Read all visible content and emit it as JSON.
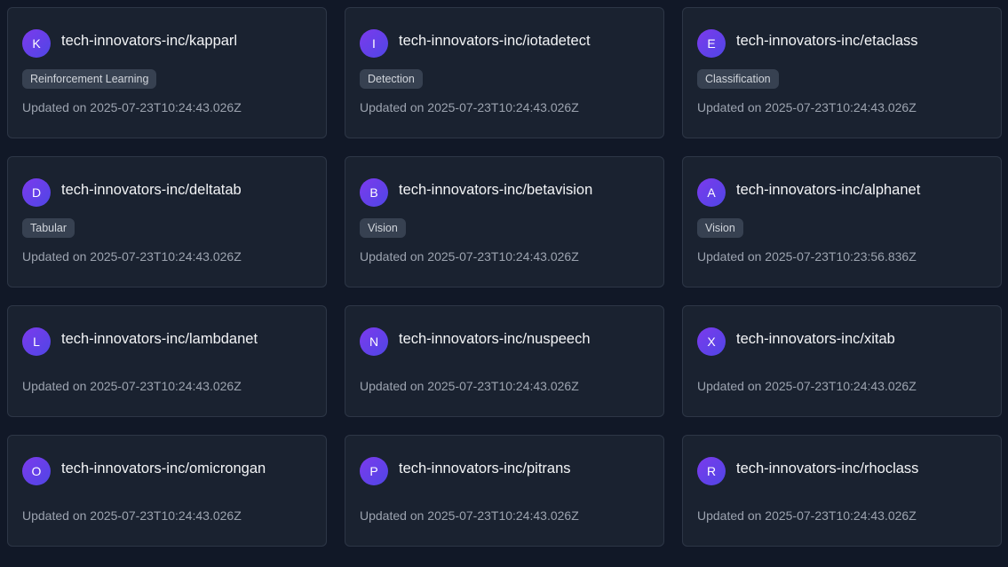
{
  "repos": [
    {
      "initial": "K",
      "name": "tech-innovators-inc/kapparl",
      "tag": "Reinforcement Learning",
      "updated": "Updated on 2025-07-23T10:24:43.026Z"
    },
    {
      "initial": "I",
      "name": "tech-innovators-inc/iotadetect",
      "tag": "Detection",
      "updated": "Updated on 2025-07-23T10:24:43.026Z"
    },
    {
      "initial": "E",
      "name": "tech-innovators-inc/etaclass",
      "tag": "Classification",
      "updated": "Updated on 2025-07-23T10:24:43.026Z"
    },
    {
      "initial": "D",
      "name": "tech-innovators-inc/deltatab",
      "tag": "Tabular",
      "updated": "Updated on 2025-07-23T10:24:43.026Z"
    },
    {
      "initial": "B",
      "name": "tech-innovators-inc/betavision",
      "tag": "Vision",
      "updated": "Updated on 2025-07-23T10:24:43.026Z"
    },
    {
      "initial": "A",
      "name": "tech-innovators-inc/alphanet",
      "tag": "Vision",
      "updated": "Updated on 2025-07-23T10:23:56.836Z"
    },
    {
      "initial": "L",
      "name": "tech-innovators-inc/lambdanet",
      "tag": "",
      "updated": "Updated on 2025-07-23T10:24:43.026Z"
    },
    {
      "initial": "N",
      "name": "tech-innovators-inc/nuspeech",
      "tag": "",
      "updated": "Updated on 2025-07-23T10:24:43.026Z"
    },
    {
      "initial": "X",
      "name": "tech-innovators-inc/xitab",
      "tag": "",
      "updated": "Updated on 2025-07-23T10:24:43.026Z"
    },
    {
      "initial": "O",
      "name": "tech-innovators-inc/omicrongan",
      "tag": "",
      "updated": "Updated on 2025-07-23T10:24:43.026Z"
    },
    {
      "initial": "P",
      "name": "tech-innovators-inc/pitrans",
      "tag": "",
      "updated": "Updated on 2025-07-23T10:24:43.026Z"
    },
    {
      "initial": "R",
      "name": "tech-innovators-inc/rhoclass",
      "tag": "",
      "updated": "Updated on 2025-07-23T10:24:43.026Z"
    }
  ],
  "colors": {
    "background": "#111827",
    "card": "#1a2230",
    "card_border": "#2d3646",
    "avatar_gradient_start": "#7c3aed",
    "avatar_gradient_end": "#4f46e5",
    "tag_bg": "#374151"
  }
}
